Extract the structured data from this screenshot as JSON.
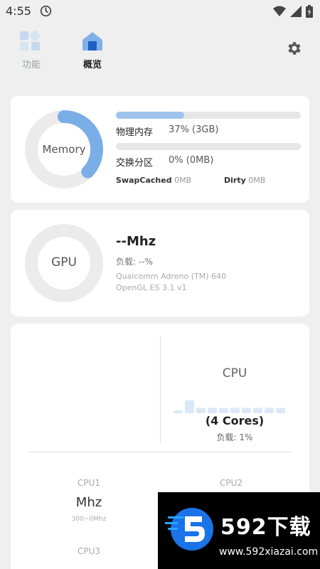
{
  "status": {
    "time": "4:55"
  },
  "nav": {
    "functions_label": "功能",
    "overview_label": "概览"
  },
  "memory": {
    "ring_label": "Memory",
    "ring_fraction": 0.37,
    "physical_label": "物理内存",
    "physical_value": "37% (3GB)",
    "physical_fraction": 0.37,
    "swap_label": "交换分区",
    "swap_value": "0% (0MB)",
    "swap_fraction": 0.0,
    "swapcached_label": "SwapCached",
    "swapcached_value": "0MB",
    "dirty_label": "Dirty",
    "dirty_value": "0MB"
  },
  "gpu": {
    "ring_label": "GPU",
    "freq": "--Mhz",
    "load": "负载: --%",
    "renderer": "Qualcomm Adreno (TM) 640",
    "api": "OpenGL ES 3.1 v1"
  },
  "cpu": {
    "title": "CPU",
    "cores_label": "(4 Cores)",
    "load": "负载: 1%",
    "history": [
      0,
      0.8,
      0.2,
      0.2,
      0.2,
      0.2,
      0.2,
      0.2,
      0.2,
      0.2
    ],
    "cores": [
      {
        "name": "CPU1",
        "freq": "Mhz",
        "range": "300~0Mhz"
      },
      {
        "name": "CPU2"
      },
      {
        "name": "CPU3"
      }
    ]
  },
  "watermark": {
    "logo_text": "592下载",
    "url": "www.592xiazai.com"
  },
  "colors": {
    "accent": "#7aaee6",
    "ring_track": "#ebebeb",
    "bar_track": "#e6e6e6"
  }
}
